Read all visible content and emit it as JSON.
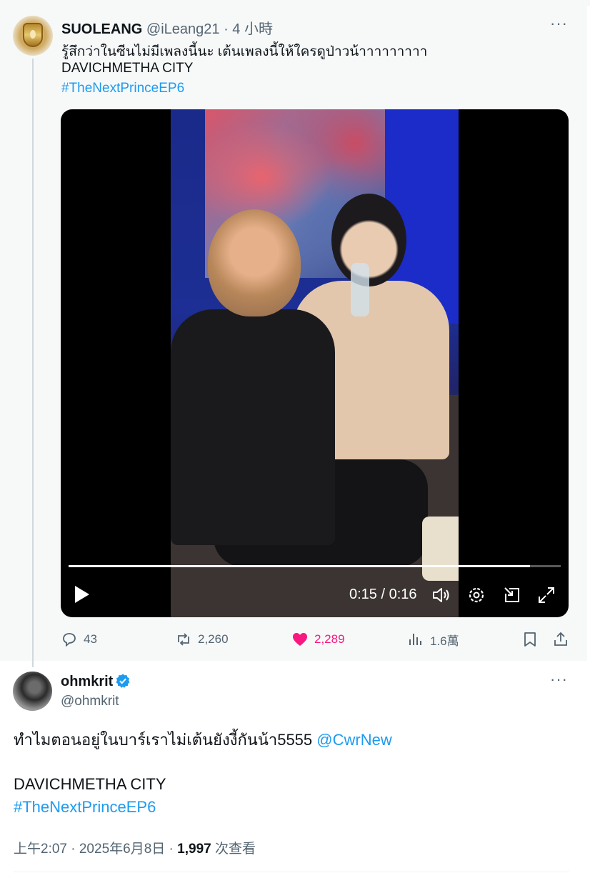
{
  "quoted_post": {
    "display_name": "SUOLEANG",
    "handle_time": "@iLeang21 · 4 小時",
    "line1": "รู้สึกว่าในซีนไม่มีเพลงนี้นะ เต้นเพลงนี้ให้ใครดูป่าวน้าาาาาาาาา",
    "line2": "DAVICHMETHA CITY",
    "hashtag": "#TheNextPrinceEP6",
    "more_icon": "···",
    "video": {
      "time": "0:15 / 0:16",
      "progress_fraction": 0.9375
    },
    "actions": {
      "replies": "43",
      "reposts": "2,260",
      "likes": "2,289",
      "views": "1.6萬"
    }
  },
  "main_post": {
    "display_name": "ohmkrit",
    "handle": "@ohmkrit",
    "more_icon": "···",
    "text_line1": "ทำไมตอนอยู่ในบาร์เราไม่เต้นยังงี้กันน้า5555",
    "mention": "@CwrNew",
    "text_line2": "DAVICHMETHA CITY",
    "hashtag": "#TheNextPrinceEP6",
    "meta_prefix": "上午2:07 · 2025年6月8日 · ",
    "view_count": "1,997",
    "view_suffix": " 次查看"
  },
  "colors": {
    "accent": "#1d9bf0",
    "like": "#f91880",
    "muted": "#536471"
  }
}
